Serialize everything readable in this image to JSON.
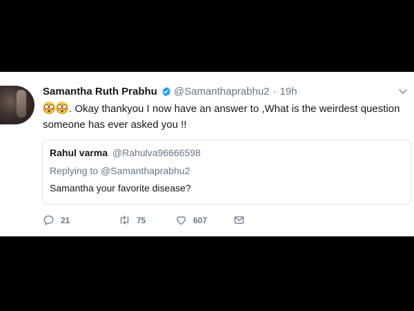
{
  "tweet": {
    "author_name": "Samantha Ruth Prabhu",
    "author_handle": "@Samanthaprabhu2",
    "separator": "·",
    "time": "19h",
    "text": ". Okay thankyou I now have an answer to ,What is the weirdest question someone has ever asked you !!",
    "emojis": [
      "flushed-face-emoji",
      "flushed-face-emoji"
    ]
  },
  "quoted_tweet": {
    "author_name": "Rahul varma",
    "author_handle": "@Rahulva96666598",
    "replying_label": "Replying to",
    "replying_to": "@Samanthaprabhu2",
    "text": "Samantha your favorite disease?"
  },
  "actions": {
    "reply_count": "21",
    "retweet_count": "75",
    "like_count": "607"
  },
  "icons": {
    "verified": "verified-badge-icon",
    "more": "chevron-down-icon",
    "reply": "reply-icon",
    "retweet": "retweet-icon",
    "like": "heart-icon",
    "message": "envelope-icon"
  },
  "colors": {
    "verified_blue": "#1da1f2",
    "muted": "#657786",
    "text": "#14171a",
    "border": "#e1e8ed"
  }
}
